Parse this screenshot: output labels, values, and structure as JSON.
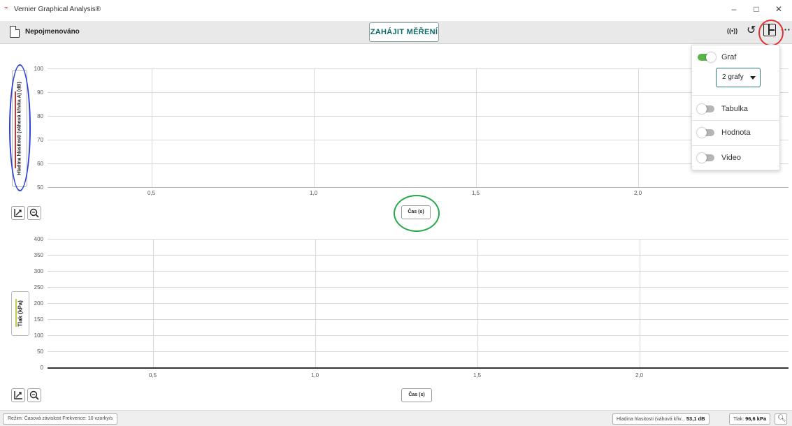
{
  "window": {
    "title": "Vernier Graphical Analysis®",
    "minimize": "–",
    "maximize": "□",
    "close": "✕"
  },
  "toolbar": {
    "document_name": "Nepojmenováno",
    "start_button": "ZAHÁJIT MĚŘENÍ",
    "sensor_icon": "((•))",
    "undo_icon": "↺",
    "more_icon": "···"
  },
  "graph1": {
    "y_label": "Hladina hlasitosti (váhová křivka A) (dB)",
    "y_ticks": [
      "100",
      "90",
      "80",
      "70",
      "60",
      "50"
    ],
    "x_ticks": [
      "0,5",
      "1,0",
      "1,5",
      "2,0"
    ],
    "x_label": "Čas (s)"
  },
  "graph2": {
    "y_label": "Tlak (kPa)",
    "y_ticks": [
      "400",
      "350",
      "300",
      "250",
      "200",
      "150",
      "100",
      "50",
      "0"
    ],
    "x_ticks": [
      "0,5",
      "1,0",
      "1,5",
      "2,0"
    ],
    "x_label": "Čas (s)"
  },
  "view_menu": {
    "items": [
      {
        "label": "Graf",
        "enabled": true
      },
      {
        "label": "Tabulka",
        "enabled": false
      },
      {
        "label": "Hodnota",
        "enabled": false
      },
      {
        "label": "Video",
        "enabled": false
      }
    ],
    "graph_count": "2 grafy"
  },
  "status": {
    "mode": "Režim: Časová závislost   Frekvence: 10 vzorky/s",
    "sound_label": "Hladina hlasitosti (váhová křiv...",
    "sound_value": "53,1 dB",
    "pressure_label": "Tlak:",
    "pressure_value": "96,6 kPa"
  },
  "colors": {
    "accent": "#0f6b6b",
    "toggle_on": "#58b548",
    "annotation_red": "#e03030",
    "annotation_blue": "#2a3fd6",
    "annotation_green": "#27a84a"
  }
}
